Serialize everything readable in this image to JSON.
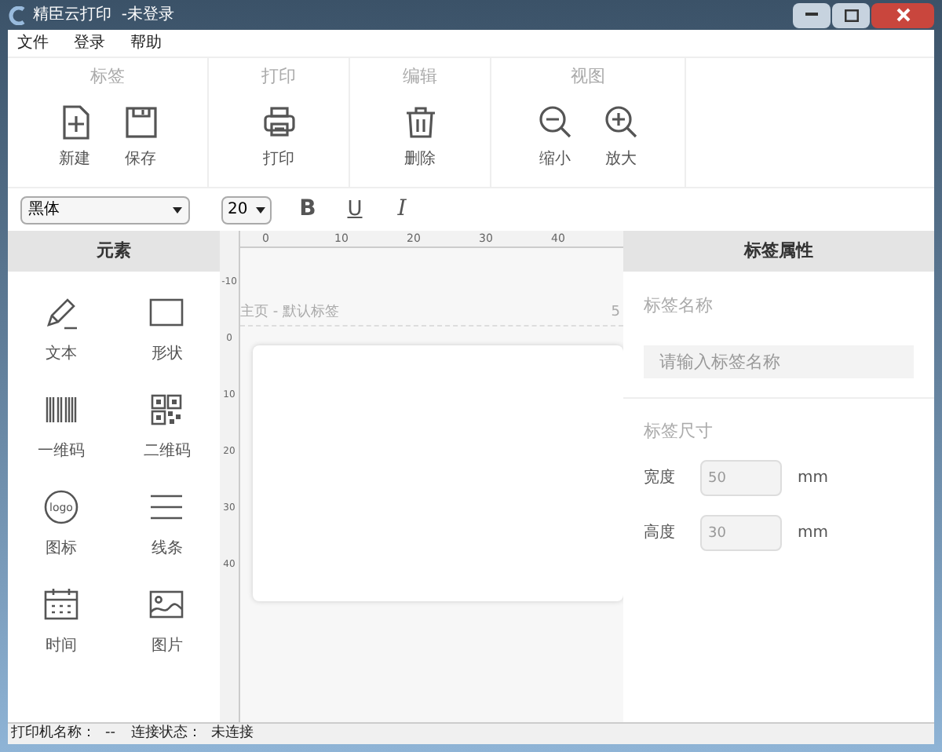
{
  "window": {
    "title": "精臣云打印  -未登录"
  },
  "menu": [
    "文件",
    "登录",
    "帮助"
  ],
  "ribbon": [
    {
      "group": "标签",
      "buttons": [
        {
          "kind": "new",
          "label": "新建"
        },
        {
          "kind": "save",
          "label": "保存"
        }
      ]
    },
    {
      "group": "打印",
      "buttons": [
        {
          "kind": "print",
          "label": "打印"
        }
      ]
    },
    {
      "group": "编辑",
      "buttons": [
        {
          "kind": "delete",
          "label": "删除"
        }
      ]
    },
    {
      "group": "视图",
      "buttons": [
        {
          "kind": "zoom_out",
          "label": "缩小"
        },
        {
          "kind": "zoom_in",
          "label": "放大"
        }
      ]
    }
  ],
  "format_bar": {
    "font": "黑体",
    "size": "20",
    "styles": [
      {
        "kind": "bold",
        "label": "B"
      },
      {
        "kind": "underline",
        "label": "U"
      },
      {
        "kind": "italic",
        "label": "I"
      }
    ]
  },
  "elements_panel": {
    "title": "元素",
    "items": [
      {
        "kind": "text",
        "label": "文本"
      },
      {
        "kind": "shape",
        "label": "形状"
      },
      {
        "kind": "barcode",
        "label": "一维码"
      },
      {
        "kind": "qrcode",
        "label": "二维码"
      },
      {
        "kind": "logo",
        "label": "图标"
      },
      {
        "kind": "lines",
        "label": "线条"
      },
      {
        "kind": "time",
        "label": "时间"
      },
      {
        "kind": "image",
        "label": "图片"
      }
    ]
  },
  "canvas": {
    "hruler": [
      "0",
      "10",
      "20",
      "30",
      "40"
    ],
    "vruler": [
      "-10",
      "0",
      "10",
      "20",
      "30",
      "40"
    ],
    "caption": "主页 - 默认标签",
    "width_mark": "5"
  },
  "properties": {
    "title": "标签属性",
    "name_label": "标签名称",
    "name_placeholder": "请输入标签名称",
    "size_label": "标签尺寸",
    "fields": [
      {
        "label": "宽度",
        "value": "50",
        "unit": "mm"
      },
      {
        "label": "高度",
        "value": "30",
        "unit": "mm"
      }
    ]
  },
  "status_bar": [
    {
      "label": "打印机名称：",
      "value": "--"
    },
    {
      "label": "连接状态：",
      "value": "未连接"
    }
  ]
}
